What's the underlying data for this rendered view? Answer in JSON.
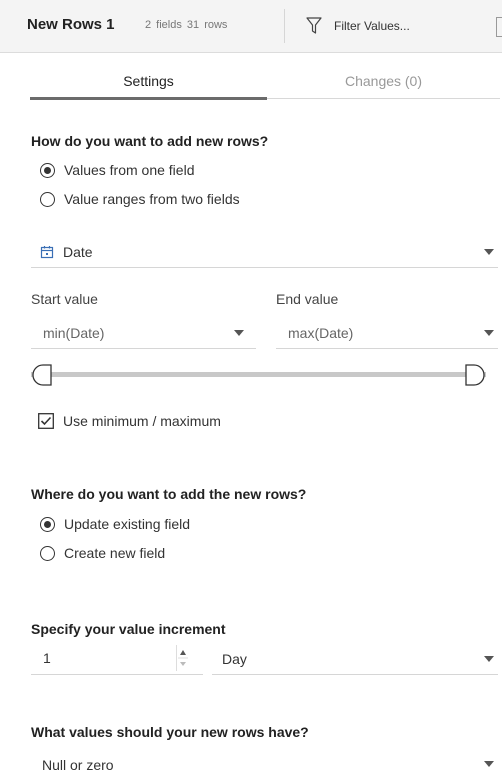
{
  "header": {
    "step_name": "New Rows 1",
    "meta": "2 fields 31 rows",
    "filter_label": "Filter Values..."
  },
  "tabs": [
    {
      "label": "Settings",
      "active": true
    },
    {
      "label": "Changes (0)",
      "active": false
    }
  ],
  "add_rows": {
    "question": "How do you want to add new rows?",
    "options": [
      {
        "label": "Values from one field",
        "selected": true
      },
      {
        "label": "Value ranges from two fields",
        "selected": false
      }
    ]
  },
  "field_select": {
    "icon": "calendar-icon",
    "value": "Date"
  },
  "range": {
    "start_label": "Start value",
    "start_value": "min(Date)",
    "end_label": "End value",
    "end_value": "max(Date)",
    "slider_start": 0,
    "slider_end": 1
  },
  "use_min_max": {
    "label": "Use minimum / maximum",
    "checked": true
  },
  "where_rows": {
    "question": "Where do you want to add the new rows?",
    "options": [
      {
        "label": "Update existing field",
        "selected": true
      },
      {
        "label": "Create new field",
        "selected": false
      }
    ]
  },
  "increment": {
    "question": "Specify your value increment",
    "value": "1",
    "unit": "Day"
  },
  "new_values": {
    "question": "What values should your new rows have?",
    "value": "Null or zero"
  },
  "colors": {
    "accent": "#6b6b6b",
    "slider_track": "#c8c8c8"
  }
}
